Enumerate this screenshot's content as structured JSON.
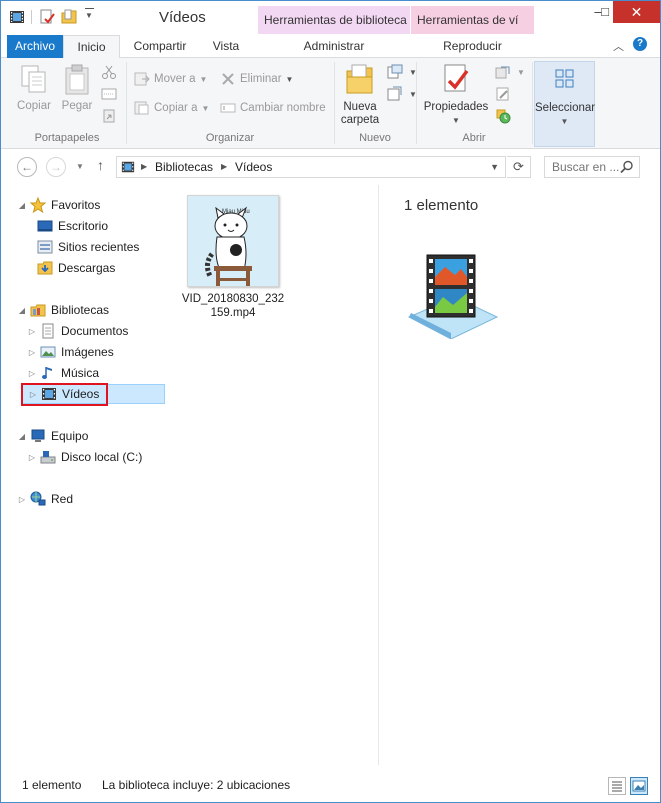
{
  "window": {
    "title": "Vídeos",
    "context_tab_1": "Herramientas de biblioteca",
    "context_tab_2": "Herramientas de ví",
    "minimize": "–",
    "maximize": "□",
    "close": "✕"
  },
  "tabs": {
    "archivo": "Archivo",
    "inicio": "Inicio",
    "compartir": "Compartir",
    "vista": "Vista",
    "administrar": "Administrar",
    "reproducir": "Reproducir"
  },
  "ribbon": {
    "copiar": "Copiar",
    "pegar": "Pegar",
    "portapapeles": "Portapapeles",
    "mover_a": "Mover a",
    "copiar_a": "Copiar a",
    "eliminar": "Eliminar",
    "cambiar_nombre": "Cambiar nombre",
    "organizar": "Organizar",
    "nueva": "Nueva",
    "carpeta": "carpeta",
    "nuevo": "Nuevo",
    "propiedades": "Propiedades",
    "abrir": "Abrir",
    "seleccionar": "Seleccionar"
  },
  "address": {
    "crumbs": [
      "Bibliotecas",
      "Vídeos"
    ],
    "search_placeholder": "Buscar en ..."
  },
  "tree": {
    "favoritos": "Favoritos",
    "escritorio": "Escritorio",
    "sitios_recientes": "Sitios recientes",
    "descargas": "Descargas",
    "bibliotecas": "Bibliotecas",
    "documentos": "Documentos",
    "imagenes": "Imágenes",
    "musica": "Música",
    "videos": "Vídeos",
    "equipo": "Equipo",
    "disco_local": "Disco local (C:)",
    "red": "Red"
  },
  "content": {
    "file_name": "VID_20180830_232159.mp4",
    "thumb_text": "Miau Miau",
    "preview_count": "1 elemento"
  },
  "status": {
    "count": "1 elemento",
    "locations": "La biblioteca incluye: 2 ubicaciones"
  },
  "colors": {
    "accent": "#1979ca",
    "selection": "#cce8ff",
    "highlight_box": "#e0141e",
    "context_tab_library": "#f3d8f3",
    "context_tab_video": "#f7cfe2"
  }
}
